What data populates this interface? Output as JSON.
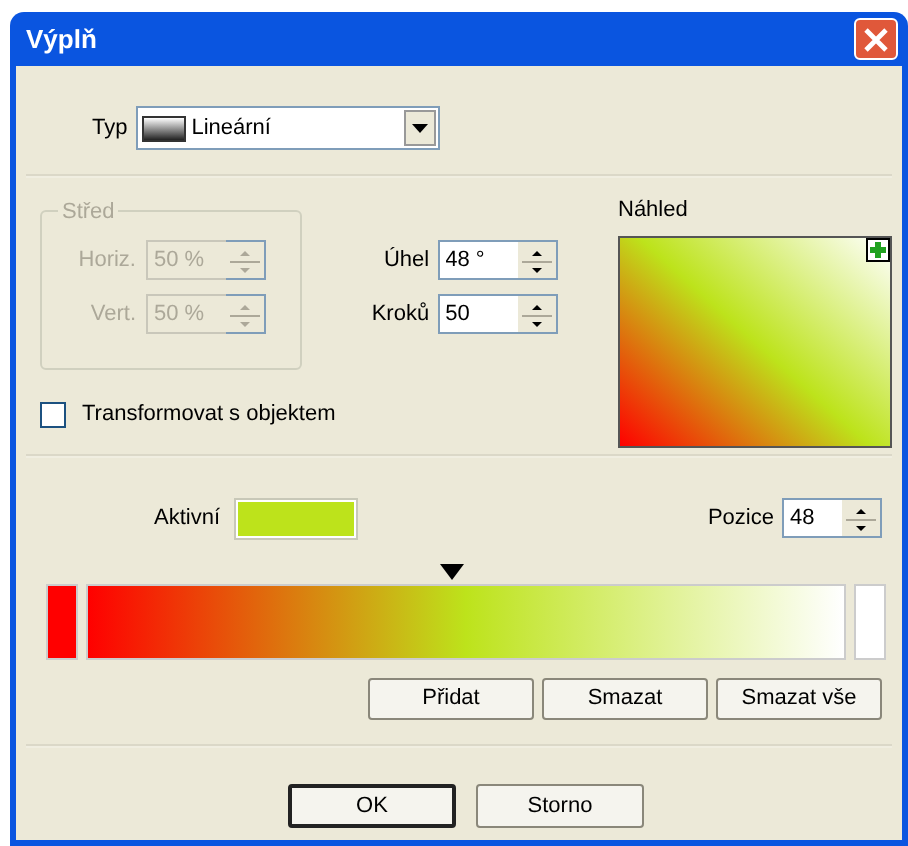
{
  "window": {
    "title": "Výplň"
  },
  "type": {
    "label": "Typ",
    "value": "Lineární"
  },
  "center": {
    "title": "Střed",
    "disabled": true,
    "fields": [
      {
        "label": "Horiz.",
        "value": "50 %"
      },
      {
        "label": "Vert.",
        "value": "50 %"
      }
    ]
  },
  "angle": {
    "label": "Úhel",
    "value": "48 °"
  },
  "steps": {
    "label": "Kroků",
    "value": "50"
  },
  "preview": {
    "label": "Náhled"
  },
  "transform": {
    "label": "Transformovat s objektem",
    "checked": false
  },
  "active": {
    "label": "Aktivní",
    "color": "#bde31b"
  },
  "position": {
    "label": "Pozice",
    "value": "48"
  },
  "gradient": {
    "marker": {
      "level": 0.48
    },
    "stops": [
      {
        "color": "#ff0000"
      },
      {
        "color": "#bde31b"
      },
      {
        "color": "#ffffff"
      }
    ]
  },
  "stop_buttons": [
    {
      "label": "Přidat"
    },
    {
      "label": "Smazat"
    },
    {
      "label": "Smazat vše"
    }
  ],
  "dialog_buttons": [
    {
      "label": "OK",
      "default": true
    },
    {
      "label": "Storno",
      "default": false
    }
  ]
}
